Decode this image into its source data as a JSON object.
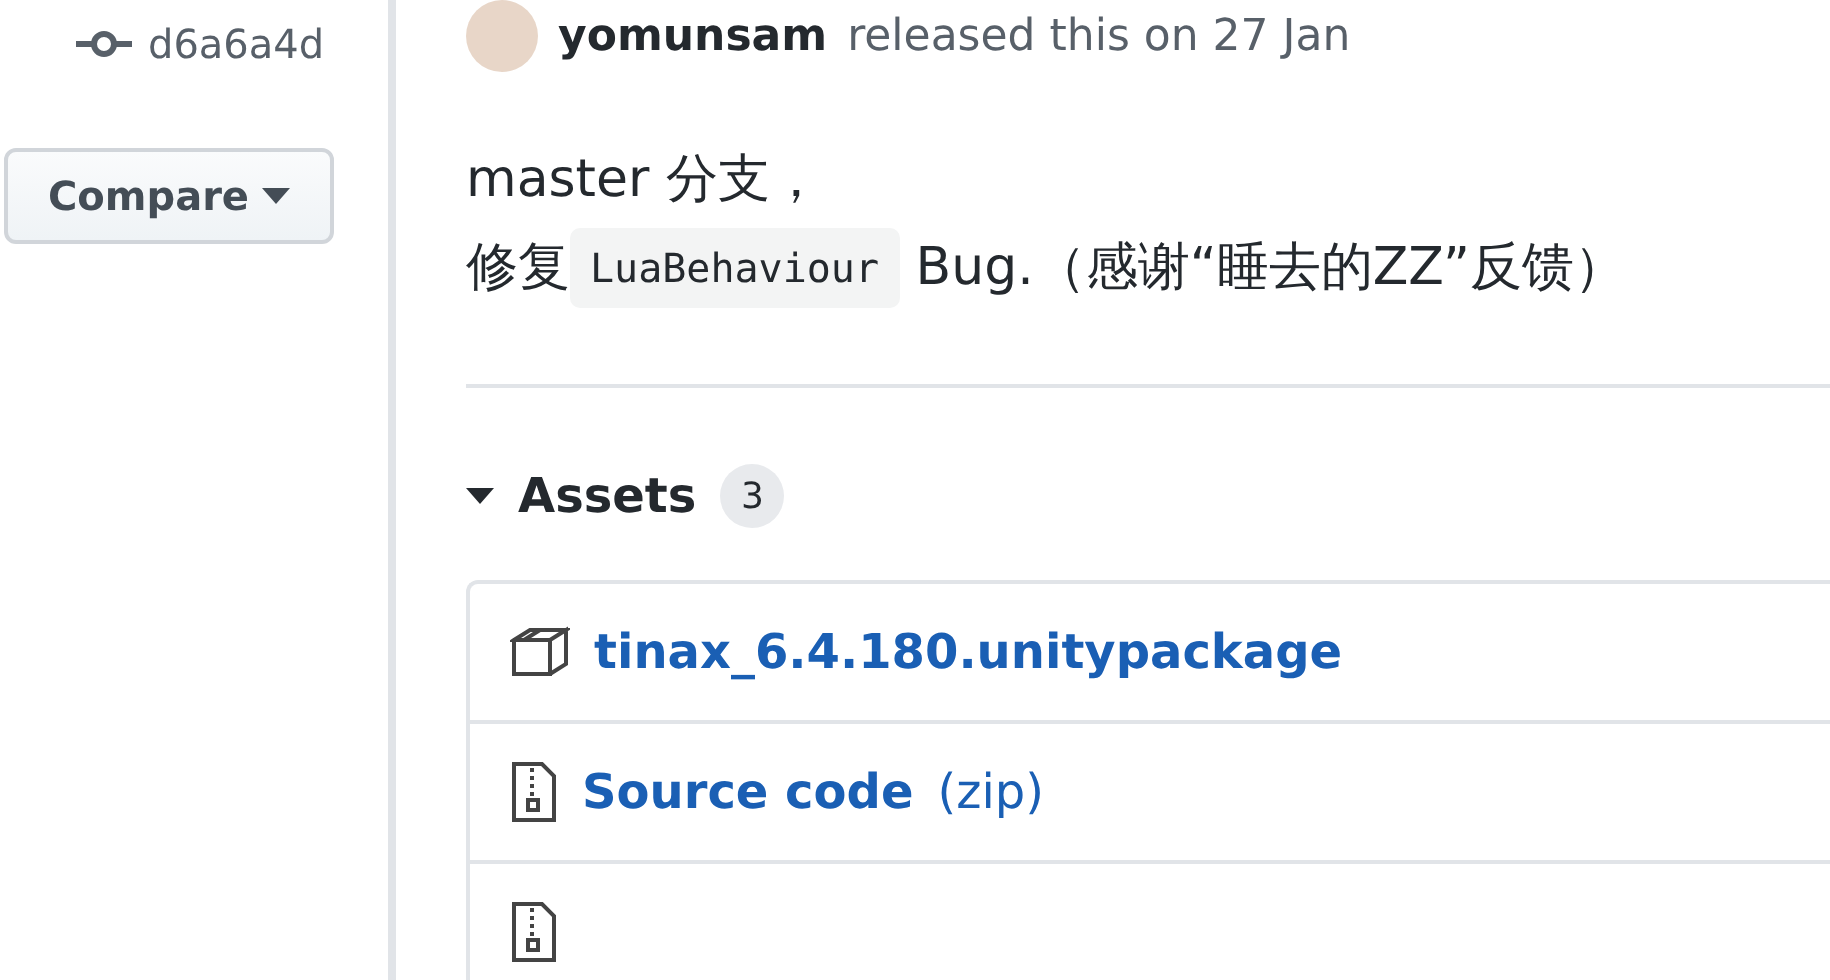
{
  "sidebar": {
    "commit": "d6a6a4d",
    "compare_button": "Compare"
  },
  "release": {
    "author": "yomunsam",
    "byline": "released this on 27 Jan",
    "body": [
      [
        {
          "kind": "text",
          "text": "master 分支，"
        }
      ],
      [
        {
          "kind": "text",
          "text": "修复"
        },
        {
          "kind": "code",
          "text": "LuaBehaviour"
        },
        {
          "kind": "text",
          "text": " Bug.（感谢“睡去的ZZ”反馈）"
        }
      ]
    ]
  },
  "assets": {
    "title": "Assets",
    "count": "3",
    "expanded": true,
    "items": [
      {
        "kind": "package",
        "name": "tinax_6.4.180.unitypackage"
      },
      {
        "kind": "archive",
        "name": "Source code",
        "suffix": "(zip)"
      },
      {
        "kind": "archive"
      }
    ]
  }
}
